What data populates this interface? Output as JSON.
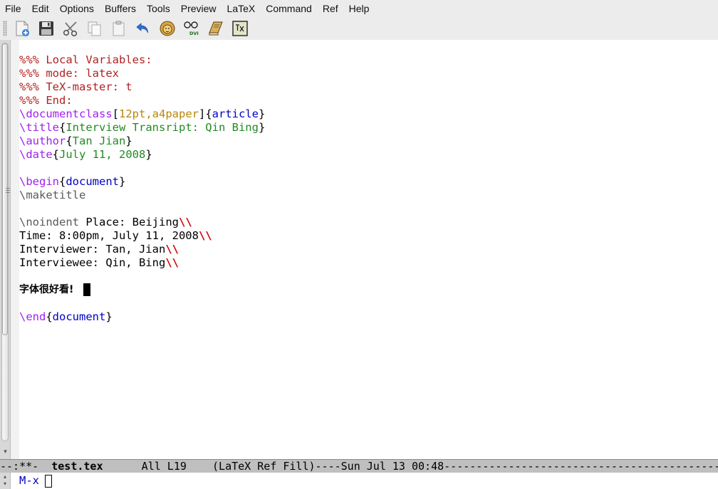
{
  "menubar": {
    "items": [
      "File",
      "Edit",
      "Options",
      "Buffers",
      "Tools",
      "Preview",
      "LaTeX",
      "Command",
      "Ref",
      "Help"
    ]
  },
  "toolbar": {
    "buttons": [
      {
        "icon": "new-file-icon"
      },
      {
        "icon": "save-icon"
      },
      {
        "icon": "cut-icon"
      },
      {
        "icon": "copy-icon"
      },
      {
        "icon": "paste-icon"
      },
      {
        "icon": "undo-icon"
      },
      {
        "icon": "latex-lion-icon"
      },
      {
        "icon": "view-dvi-icon"
      },
      {
        "icon": "bibtex-book-icon"
      },
      {
        "icon": "tex-file-icon"
      }
    ],
    "dvi_label": "DVI"
  },
  "editor": {
    "lines": {
      "l1": "%%% Local Variables:",
      "l2": "%%% mode: latex",
      "l3": "%%% TeX-master: t",
      "l4": "%%% End:",
      "l5_cmd": "\\documentclass",
      "l5_open": "[",
      "l5_opt": "12pt,a4paper",
      "l5_mid": "]{",
      "l5_arg": "article",
      "l5_close": "}",
      "l6_cmd": "\\title",
      "l6_open": "{",
      "l6_arg": "Interview Transript: Qin Bing",
      "l6_close": "}",
      "l7_cmd": "\\author",
      "l7_open": "{",
      "l7_arg": "Tan Jian",
      "l7_close": "}",
      "l8_cmd": "\\date",
      "l8_open": "{",
      "l8_arg": "July 11, 2008",
      "l8_close": "}",
      "l10_cmd": "\\begin",
      "l10_open": "{",
      "l10_arg": "document",
      "l10_close": "}",
      "l11": "\\maketitle",
      "l13_cmd": "\\noindent",
      "l13_text": " Place: Beijing",
      "l13_break": "\\\\",
      "l14_text": "Time: 8:00pm, July 11, 2008",
      "l14_break": "\\\\",
      "l15_text": "Interviewer: Tan, Jian",
      "l15_break": "\\\\",
      "l16_text": "Interviewee: Qin, Bing",
      "l16_break": "\\\\",
      "l18": "字体很好看!",
      "l20_cmd": "\\end",
      "l20_open": "{",
      "l20_arg": "document",
      "l20_close": "}"
    }
  },
  "modeline": {
    "prefix": "--:**-  ",
    "buffer_name": "test.tex",
    "suffix": "      All L19    (LaTeX Ref Fill)----Sun Jul 13 00:48-----------------------------------------------"
  },
  "minibuffer": {
    "prompt": "M-x"
  },
  "colors": {
    "comment": "#b22222",
    "macro": "#a020f0",
    "option": "#b8860b",
    "argument": "#228b22",
    "environment": "#0000c8",
    "linebreak": "#d00000"
  }
}
